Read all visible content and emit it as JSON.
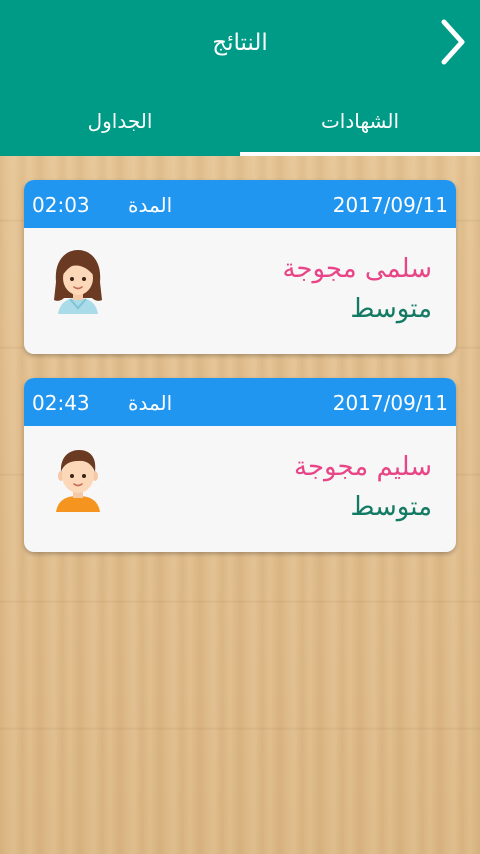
{
  "header": {
    "title": "النتائج",
    "back_icon": "chevron-right-icon",
    "color": "#009b86"
  },
  "tabs": [
    {
      "label": "الشهادات",
      "active": true
    },
    {
      "label": "الجداول",
      "active": false
    }
  ],
  "results": [
    {
      "date": "2017/09/11",
      "duration_label": "المدة",
      "duration": "02:03",
      "name": "سلمى مجوجة",
      "level": "متوسط",
      "avatar": "girl-avatar-icon"
    },
    {
      "date": "2017/09/11",
      "duration_label": "المدة",
      "duration": "02:43",
      "name": "سليم مجوجة",
      "level": "متوسط",
      "avatar": "boy-avatar-icon"
    }
  ],
  "colors": {
    "card_header": "#2196f0",
    "name": "#e84587",
    "level": "#137a63"
  }
}
